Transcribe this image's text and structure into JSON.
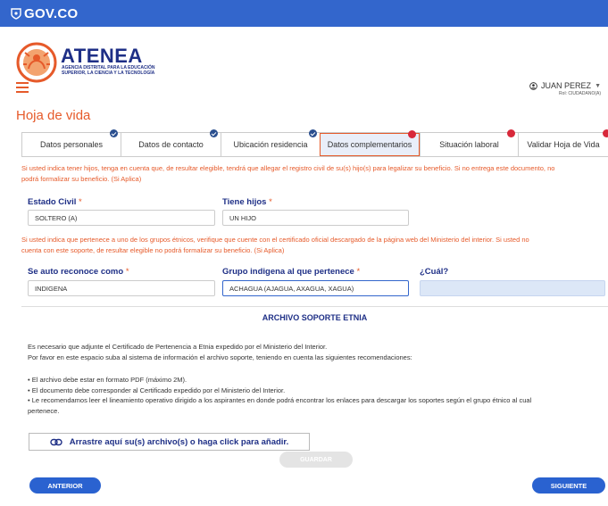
{
  "gov_bar": {
    "brand": "GOV.CO",
    "color": "#3366cc"
  },
  "logo": {
    "title": "ATENEA",
    "subtitle_line1": "AGENCIA DISTRITAL PARA LA EDUCACIÓN",
    "subtitle_line2": "SUPERIOR, LA CIENCIA Y LA TECNOLOGÍA"
  },
  "user": {
    "name": "JUAN PEREZ",
    "role": "Rol: CIUDADANO(A)"
  },
  "page_title": "Hoja de vida",
  "tabs": [
    {
      "label": "Datos personales",
      "status": "complete"
    },
    {
      "label": "Datos de contacto",
      "status": "complete"
    },
    {
      "label": "Ubicación residencia",
      "status": "complete"
    },
    {
      "label": "Datos complementarios",
      "status": "pending",
      "active": true
    },
    {
      "label": "Situación laboral",
      "status": "pending"
    },
    {
      "label": "Validar Hoja de Vida",
      "status": "pending"
    }
  ],
  "warnings": {
    "children_line1": "Si usted indica tener hijos, tenga en cuenta que, de resultar elegible, tendrá que allegar el registro civil de su(s) hijo(s) para legalizar su beneficio. Si no entrega este documento, no",
    "children_line2": "podrá formalizar su beneficio. (Si Aplica)",
    "ethnic_line1": "Si usted indica que pertenece a uno de los grupos étnicos, verifique que cuente con el certificado oficial descargado de la página web del Ministerio del interior. Si usted no",
    "ethnic_line2": "cuenta con este soporte, de resultar elegible no podrá formalizar su beneficio. (Si Aplica)"
  },
  "form": {
    "estado_civil": {
      "label": "Estado Civil",
      "required": "*",
      "value": "SOLTERO (A)"
    },
    "tiene_hijos": {
      "label": "Tiene hijos",
      "required": "*",
      "value": "UN HIJO"
    },
    "auto_reconoce": {
      "label": "Se auto reconoce como",
      "required": "*",
      "value": "INDIGENA"
    },
    "grupo_indigena": {
      "label": "Grupo indigena al que pertenece",
      "required": "*",
      "value": "ACHAGUA (AJAGUA, AXAGUA, XAGUA)"
    },
    "cual": {
      "label": "¿Cuál?",
      "value": ""
    }
  },
  "soporte": {
    "title": "ARCHIVO SOPORTE ETNIA",
    "intro1": "Es necesario que adjunte el Certificado de Pertenencia a Etnia expedido por el Ministerio del Interior.",
    "intro2": "Por favor en este espacio suba al sistema de información el archivo soporte, teniendo en cuenta las siguientes recomendaciones:",
    "bullet1": "•  El archivo debe estar en formato PDF (máximo 2M).",
    "bullet2": "•  El documento debe corresponder al Certificado expedido por el Ministerio del Interior.",
    "bullet3a": "•  Le recomendamos leer el lineamiento operativo dirigido a los aspirantes en donde podrá encontrar los enlaces para descargar los soportes según el grupo étnico al cual",
    "bullet3b": "pertenece.",
    "dropzone": "Arrastre aquí su(s) archivo(s) o haga click para añadir."
  },
  "buttons": {
    "save": "GUARDAR",
    "previous": "ANTERIOR",
    "next": "SIGUIENTE"
  },
  "colors": {
    "accent": "#e65a2a",
    "navy": "#1e2f86",
    "primary_button": "#2a62d0",
    "complete_badge": "#2a4f8f",
    "pending_badge": "#d8283a"
  }
}
